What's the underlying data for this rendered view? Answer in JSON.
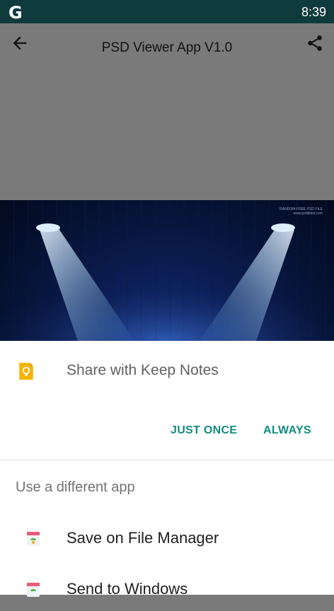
{
  "status_bar": {
    "logo": "G",
    "time": "8:39"
  },
  "app_bar": {
    "title": "PSD Viewer App V1.0"
  },
  "image": {
    "watermark_line1": "RANDOM-FREE PSD FILE",
    "watermark_line2": "www.psdblast.com"
  },
  "share_sheet": {
    "primary_app_label": "Share with Keep Notes",
    "just_once_label": "JUST ONCE",
    "always_label": "ALWAYS",
    "different_app_header": "Use a different app",
    "apps": [
      {
        "label": "Save on File Manager",
        "icon": "file-manager-icon"
      },
      {
        "label": "Send to Windows",
        "icon": "send-to-windows-icon"
      }
    ]
  },
  "colors": {
    "status_bar": "#0f3b3d",
    "accent": "#118d80",
    "keep_yellow": "#f6b400"
  }
}
